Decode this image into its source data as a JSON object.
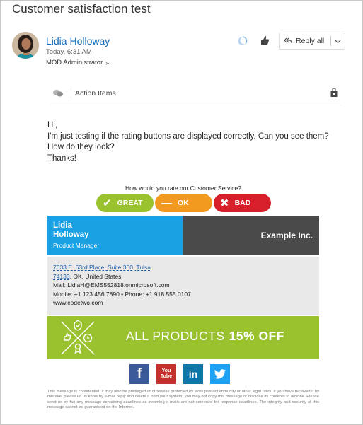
{
  "email": {
    "subject": "Customer satisfaction test",
    "sender": "Lidia Holloway",
    "date": "Today, 6:31 AM",
    "to": "MOD Administrator",
    "toolbar": {
      "reply_all_label": "Reply all"
    }
  },
  "addin": {
    "label": "Action Items"
  },
  "body": {
    "lines": [
      "Hi,",
      "I'm just testing if the rating buttons are displayed correctly. Can you see them?",
      "How do they look?",
      "Thanks!"
    ]
  },
  "rating": {
    "question": "How would you rate our Customer Service?",
    "buttons": [
      {
        "label": "GREAT",
        "symbol": "✔",
        "color": "#9ac12e"
      },
      {
        "label": "OK",
        "symbol": "—",
        "color": "#f29a1f"
      },
      {
        "label": "BAD",
        "symbol": "✖",
        "color": "#d71f2c"
      }
    ]
  },
  "signature": {
    "first_name": "Lidia",
    "last_name": "Holloway",
    "title": "Product Manager",
    "company": "Example Inc.",
    "address_line1": "7633 E. 63rd Place, Suite 300, Tulsa",
    "address_zip": "74133",
    "address_rest": ", OK, United States",
    "mail": "Mail: LidiaH@EMS552818.onmicrosoft.com",
    "phones": "Mobile: +1 123 456 7890 • Phone: +1 918 555 0107",
    "website": "www.codetwo.com",
    "colors": {
      "blue": "#1aa1e3",
      "dark": "#4a4a4a",
      "green": "#9ac12e"
    }
  },
  "banner": {
    "text": "ALL PRODUCTS",
    "highlight": "15% OFF"
  },
  "social": [
    {
      "name": "facebook",
      "glyph": "f"
    },
    {
      "name": "youtube",
      "glyph_top": "You",
      "glyph_bottom": "Tube"
    },
    {
      "name": "linkedin",
      "glyph": "in"
    },
    {
      "name": "twitter",
      "glyph": "twitter-bird-icon"
    }
  ],
  "disclaimer": "This message is confidential. It may also be privileged or otherwise protected by work product immunity or other legal rules. If you have received it by mistake, please let us know by e-mail reply and delete it from your system; you may not copy this message or disclose its contents to anyone. Please send us by fax any message containing deadlines as incoming e-mails are not screened for response deadlines. The integrity and security of this message cannot be guaranteed on the Internet."
}
